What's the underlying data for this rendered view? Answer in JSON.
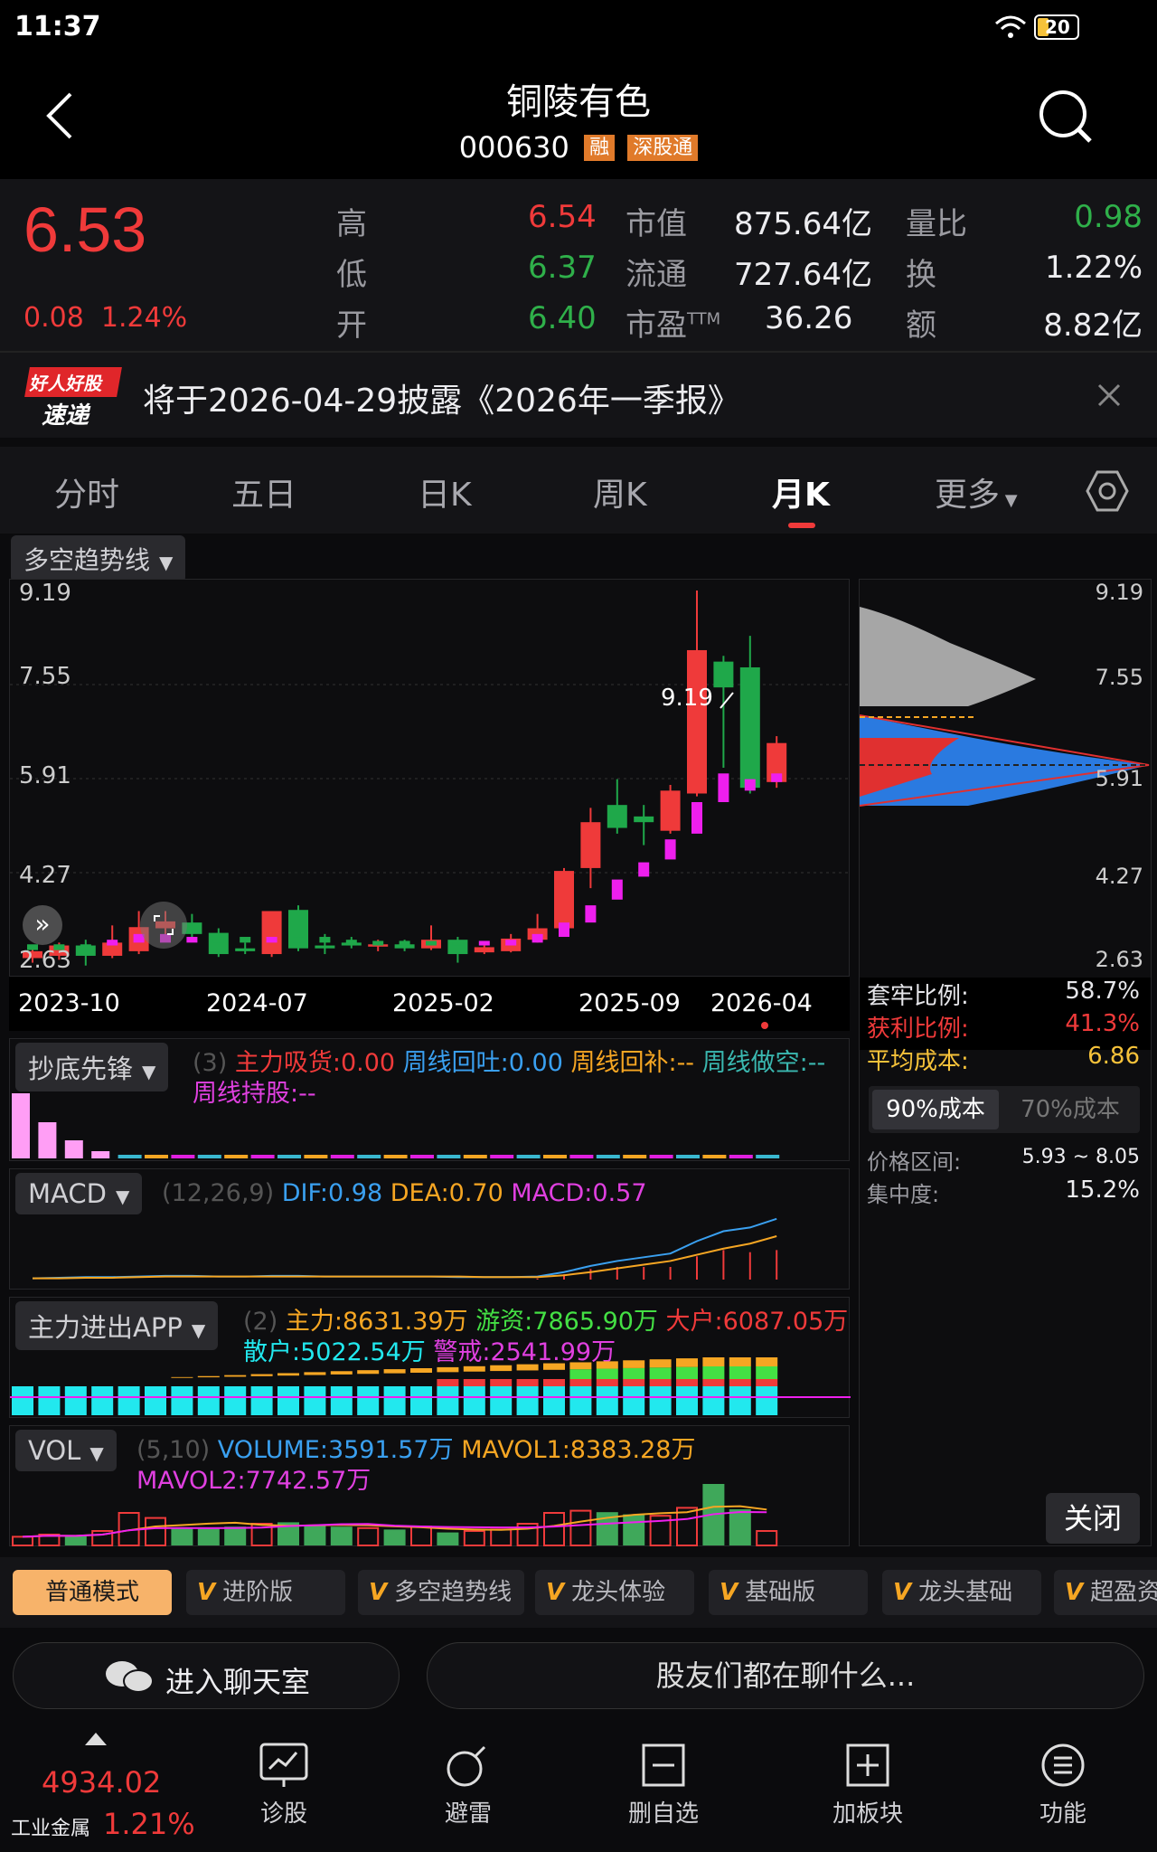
{
  "status_bar": {
    "time": "11:37",
    "battery": "20"
  },
  "header": {
    "title": "铜陵有色",
    "code": "000630",
    "badges": [
      "融",
      "深股通"
    ]
  },
  "quote": {
    "price": "6.53",
    "change": "0.08",
    "change_pct": "1.24%",
    "labels": {
      "high": "高",
      "low": "低",
      "open": "开",
      "mcap": "市值",
      "float": "流通",
      "pe": "市盈",
      "pe_sup": "TTM",
      "vol_ratio": "量比",
      "turnover": "换",
      "amount": "额"
    },
    "high": "6.54",
    "low": "6.37",
    "open": "6.40",
    "mcap": "875.64亿",
    "float_cap": "727.64亿",
    "pe": "36.26",
    "vol_ratio": "0.98",
    "turnover": "1.22%",
    "amount": "8.82亿"
  },
  "notice": {
    "logo_top": "好人好股",
    "logo_bottom": "速递",
    "text": "将于2026-04-29披露《2026年一季报》"
  },
  "tabs": [
    "分时",
    "五日",
    "日K",
    "周K",
    "月K",
    "更多"
  ],
  "active_tab": "月K",
  "chart": {
    "indicator_select": "多空趋势线",
    "y_ticks": [
      "9.19",
      "7.55",
      "5.91",
      "4.27",
      "2.63"
    ],
    "x_ticks": [
      "2023-10",
      "2024-07",
      "2025-02",
      "2025-09",
      "2026-04"
    ],
    "max_label": "9.19",
    "min_label": "2.63",
    "chart_data": {
      "type": "candlestick",
      "ylim": [
        2.63,
        9.19
      ],
      "candles": [
        {
          "o": 2.78,
          "c": 2.9,
          "h": 2.95,
          "l": 2.7
        },
        {
          "o": 2.82,
          "c": 3.0,
          "h": 3.05,
          "l": 2.75
        },
        {
          "o": 3.0,
          "c": 2.82,
          "h": 3.1,
          "l": 2.65
        },
        {
          "o": 2.82,
          "c": 3.05,
          "h": 3.35,
          "l": 2.78
        },
        {
          "o": 2.9,
          "c": 3.32,
          "h": 3.6,
          "l": 2.85
        },
        {
          "o": 3.3,
          "c": 3.42,
          "h": 3.6,
          "l": 3.1
        },
        {
          "o": 3.4,
          "c": 3.2,
          "h": 3.55,
          "l": 3.1
        },
        {
          "o": 3.22,
          "c": 2.85,
          "h": 3.3,
          "l": 2.8
        },
        {
          "o": 2.95,
          "c": 2.9,
          "h": 3.05,
          "l": 2.85
        },
        {
          "o": 2.85,
          "c": 3.6,
          "h": 3.6,
          "l": 2.8
        },
        {
          "o": 3.62,
          "c": 2.95,
          "h": 3.7,
          "l": 2.9
        },
        {
          "o": 3.0,
          "c": 2.95,
          "h": 3.2,
          "l": 2.85
        },
        {
          "o": 3.05,
          "c": 3.0,
          "h": 3.15,
          "l": 2.95
        },
        {
          "o": 2.98,
          "c": 3.02,
          "h": 3.1,
          "l": 2.9
        },
        {
          "o": 3.02,
          "c": 2.95,
          "h": 3.1,
          "l": 2.9
        },
        {
          "o": 2.95,
          "c": 3.1,
          "h": 3.35,
          "l": 2.92
        },
        {
          "o": 3.1,
          "c": 2.85,
          "h": 3.15,
          "l": 2.7
        },
        {
          "o": 2.88,
          "c": 2.97,
          "h": 3.0,
          "l": 2.85
        },
        {
          "o": 2.9,
          "c": 3.12,
          "h": 3.2,
          "l": 2.88
        },
        {
          "o": 3.1,
          "c": 3.3,
          "h": 3.55,
          "l": 3.05
        },
        {
          "o": 3.3,
          "c": 4.3,
          "h": 4.35,
          "l": 3.25
        },
        {
          "o": 4.35,
          "c": 5.15,
          "h": 5.4,
          "l": 4.0
        },
        {
          "o": 5.45,
          "c": 5.05,
          "h": 5.9,
          "l": 4.95
        },
        {
          "o": 5.25,
          "c": 5.15,
          "h": 5.45,
          "l": 4.75
        },
        {
          "o": 5.0,
          "c": 5.7,
          "h": 5.8,
          "l": 4.95
        },
        {
          "o": 5.65,
          "c": 8.15,
          "h": 9.19,
          "l": 5.6
        },
        {
          "o": 7.95,
          "c": 7.5,
          "h": 8.05,
          "l": 6.1
        },
        {
          "o": 7.85,
          "c": 5.75,
          "h": 8.4,
          "l": 5.65
        },
        {
          "o": 5.85,
          "c": 6.53,
          "h": 6.65,
          "l": 5.75
        }
      ],
      "trend_markers": [
        {
          "lo": 2.92,
          "hi": 3.02,
          "color": "green"
        },
        {
          "lo": 2.92,
          "hi": 3.02,
          "color": "green"
        },
        {
          "lo": 2.92,
          "hi": 3.02,
          "color": "green"
        },
        {
          "lo": 3.0,
          "hi": 3.1,
          "color": "magenta"
        },
        {
          "lo": 3.05,
          "hi": 3.2,
          "color": "magenta"
        },
        {
          "lo": 3.05,
          "hi": 3.2,
          "color": "magenta"
        },
        {
          "lo": 3.05,
          "hi": 3.15,
          "color": "magenta"
        },
        {
          "lo": 3.05,
          "hi": 3.15,
          "color": "green"
        },
        {
          "lo": 3.05,
          "hi": 3.15,
          "color": "green"
        },
        {
          "lo": 3.05,
          "hi": 3.15,
          "color": "magenta"
        },
        {
          "lo": 3.05,
          "hi": 3.15,
          "color": "green"
        },
        {
          "lo": 3.05,
          "hi": 3.15,
          "color": "green"
        },
        {
          "lo": 3.0,
          "hi": 3.1,
          "color": "green"
        },
        {
          "lo": 3.0,
          "hi": 3.08,
          "color": "green"
        },
        {
          "lo": 3.0,
          "hi": 3.08,
          "color": "green"
        },
        {
          "lo": 3.0,
          "hi": 3.08,
          "color": "green"
        },
        {
          "lo": 3.0,
          "hi": 3.08,
          "color": "green"
        },
        {
          "lo": 3.0,
          "hi": 3.08,
          "color": "magenta"
        },
        {
          "lo": 3.0,
          "hi": 3.1,
          "color": "magenta"
        },
        {
          "lo": 3.05,
          "hi": 3.2,
          "color": "magenta"
        },
        {
          "lo": 3.15,
          "hi": 3.4,
          "color": "magenta"
        },
        {
          "lo": 3.4,
          "hi": 3.7,
          "color": "magenta"
        },
        {
          "lo": 3.8,
          "hi": 4.15,
          "color": "magenta"
        },
        {
          "lo": 4.2,
          "hi": 4.45,
          "color": "magenta"
        },
        {
          "lo": 4.5,
          "hi": 4.85,
          "color": "magenta"
        },
        {
          "lo": 4.95,
          "hi": 5.5,
          "color": "magenta"
        },
        {
          "lo": 5.5,
          "hi": 6.0,
          "color": "magenta"
        },
        {
          "lo": 5.7,
          "hi": 5.9,
          "color": "magenta"
        },
        {
          "lo": 5.85,
          "hi": 6.0,
          "color": "magenta"
        }
      ]
    }
  },
  "chips": {
    "y_ticks": [
      "9.19",
      "7.55",
      "5.91",
      "4.27",
      "2.63"
    ],
    "rows": [
      {
        "label": "套牢比例:",
        "value": "58.7%",
        "color": "#e6e6ea"
      },
      {
        "label": "获利比例:",
        "value": "41.3%",
        "color": "#f03a3a"
      },
      {
        "label": "平均成本:",
        "value": "6.86",
        "color": "#f6c23a"
      }
    ],
    "tabs": [
      "90%成本",
      "70%成本"
    ],
    "range_label": "价格区间:",
    "range_value": "5.93 ~ 8.05",
    "conc_label": "集中度:",
    "conc_value": "15.2%",
    "close_label": "关闭"
  },
  "ind1": {
    "name": "抄底先锋",
    "param": "(3)",
    "items": [
      {
        "text": "主力吸货:0.00",
        "color": "#f03a3a"
      },
      {
        "text": "周线回吐:0.00",
        "color": "#3aa0f0"
      },
      {
        "text": "周线回补:--",
        "color": "#f6a623"
      },
      {
        "text": "周线做空:--",
        "color": "#3ab8b0"
      },
      {
        "text": "周线持股:--",
        "color": "#e040e0"
      }
    ],
    "bars": [
      0.9,
      0.5,
      0.25,
      0.1
    ]
  },
  "ind2": {
    "name": "MACD",
    "param": "(12,26,9)",
    "items": [
      {
        "text": "DIF:0.98",
        "color": "#3aa0f0"
      },
      {
        "text": "DEA:0.70",
        "color": "#f6a623"
      },
      {
        "text": "MACD:0.57",
        "color": "#e040e0"
      }
    ],
    "dif": [
      0.02,
      0.03,
      0.04,
      0.04,
      0.05,
      0.06,
      0.06,
      0.05,
      0.05,
      0.06,
      0.06,
      0.05,
      0.05,
      0.05,
      0.05,
      0.05,
      0.04,
      0.04,
      0.04,
      0.05,
      0.12,
      0.22,
      0.3,
      0.36,
      0.42,
      0.62,
      0.78,
      0.84,
      0.98
    ],
    "dea": [
      0.02,
      0.02,
      0.03,
      0.03,
      0.04,
      0.05,
      0.05,
      0.05,
      0.05,
      0.05,
      0.05,
      0.05,
      0.05,
      0.05,
      0.05,
      0.05,
      0.05,
      0.04,
      0.04,
      0.04,
      0.07,
      0.12,
      0.18,
      0.24,
      0.3,
      0.4,
      0.5,
      0.58,
      0.7
    ],
    "max": 1.05
  },
  "ind3": {
    "name": "主力进出APP",
    "param": "(2)",
    "items": [
      {
        "text": "主力:8631.39万",
        "color": "#f6a623"
      },
      {
        "text": "游资:7865.90万",
        "color": "#44e044"
      },
      {
        "text": "大户:6087.05万",
        "color": "#f03a3a"
      },
      {
        "text": "散户:5022.54万",
        "color": "#22e8ee"
      },
      {
        "text": "警戒:2541.99万",
        "color": "#e040e0"
      }
    ]
  },
  "ind4": {
    "name": "VOL",
    "param": "(5,10)",
    "items": [
      {
        "text": "VOLUME:3591.57万",
        "color": "#3aa0f0"
      },
      {
        "text": "MAVOL1:8383.28万",
        "color": "#f6a623"
      },
      {
        "text": "MAVOL2:7742.57万",
        "color": "#e040e0"
      }
    ],
    "volumes": [
      1.2,
      1.5,
      1.3,
      2.0,
      4.5,
      3.8,
      2.5,
      2.3,
      2.6,
      3.0,
      3.2,
      2.8,
      2.6,
      2.4,
      2.2,
      2.6,
      1.8,
      2.0,
      2.2,
      3.0,
      4.5,
      4.8,
      4.6,
      4.3,
      4.1,
      5.2,
      8.5,
      5.0,
      2.0
    ],
    "max": 9.0
  },
  "modes": [
    "普通模式",
    "进阶版",
    "多空趋势线",
    "龙头体验",
    "基础版",
    "龙头基础",
    "超盈资"
  ],
  "chat": {
    "enter": "进入聊天室",
    "topic": "股友们都在聊什么..."
  },
  "footer": {
    "index_value": "4934.02",
    "index_name": "工业金属",
    "index_pct": "1.21%",
    "items": [
      {
        "label": "诊股",
        "icon": "chart-icon"
      },
      {
        "label": "避雷",
        "icon": "bomb-icon"
      },
      {
        "label": "删自选",
        "icon": "minus-box-icon"
      },
      {
        "label": "加板块",
        "icon": "plus-box-icon"
      },
      {
        "label": "功能",
        "icon": "menu-icon"
      }
    ]
  }
}
